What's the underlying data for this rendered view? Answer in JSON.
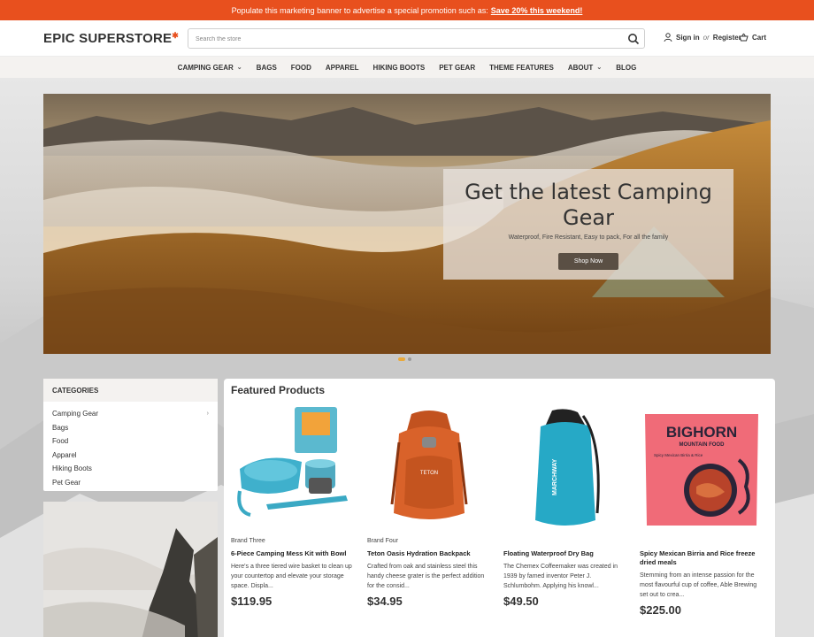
{
  "promo": {
    "text": "Populate this marketing banner to advertise a special promotion such as:",
    "link": "Save 20% this weekend!"
  },
  "header": {
    "logo": "EPIC SUPERSTORE",
    "search_placeholder": "Search the store",
    "sign_in": "Sign in",
    "or": "or",
    "register": "Register",
    "cart": "Cart"
  },
  "nav": {
    "items": [
      "CAMPING GEAR",
      "BAGS",
      "FOOD",
      "APPAREL",
      "HIKING BOOTS",
      "PET GEAR",
      "THEME FEATURES",
      "ABOUT",
      "BLOG"
    ]
  },
  "hero": {
    "title": "Get the latest Camping Gear",
    "subtitle": "Waterproof, Fire Resistant, Easy to pack, For all the family",
    "button": "Shop Now"
  },
  "categories": {
    "title": "CATEGORIES",
    "items": [
      "Camping Gear",
      "Bags",
      "Food",
      "Apparel",
      "Hiking Boots",
      "Pet Gear"
    ]
  },
  "featured": {
    "title": "Featured Products",
    "products": [
      {
        "brand": "Brand Three",
        "name": "6-Piece Camping Mess Kit with Bowl",
        "desc": "Here's a three tiered wire basket to clean up your countertop and elevate your storage space. Displa...",
        "price": "$119.95"
      },
      {
        "brand": "Brand Four",
        "name": "Teton Oasis Hydration Backpack",
        "desc": "Crafted from oak and stainless steel this handy cheese grater is the perfect addition for the consid...",
        "price": "$34.95"
      },
      {
        "brand": "",
        "name": "Floating Waterproof Dry Bag",
        "desc": "The Chemex Coffeemaker was created in 1939 by famed inventor Peter J. Schlumbohm. Applying his knowl...",
        "price": "$49.50"
      },
      {
        "brand": "",
        "name": "Spicy Mexican Birria and Rice freeze dried meals",
        "desc": "Stemming from an intense passion for the most flavourful cup of coffee, Able Brewing set out to crea...",
        "price": "$225.00"
      }
    ]
  },
  "product_labels": {
    "bag_brand": "MARCHWAY",
    "food_brand_line1": "BIGHORN",
    "food_brand_line2": "MOUNTAIN FOOD",
    "food_flavor": "Spicy Mexican Birria & Rice",
    "backpack_brand": "TETON"
  },
  "colors": {
    "accent": "#e8501e",
    "dark_button": "#5a4f44",
    "dot_active": "#e8a93c"
  }
}
